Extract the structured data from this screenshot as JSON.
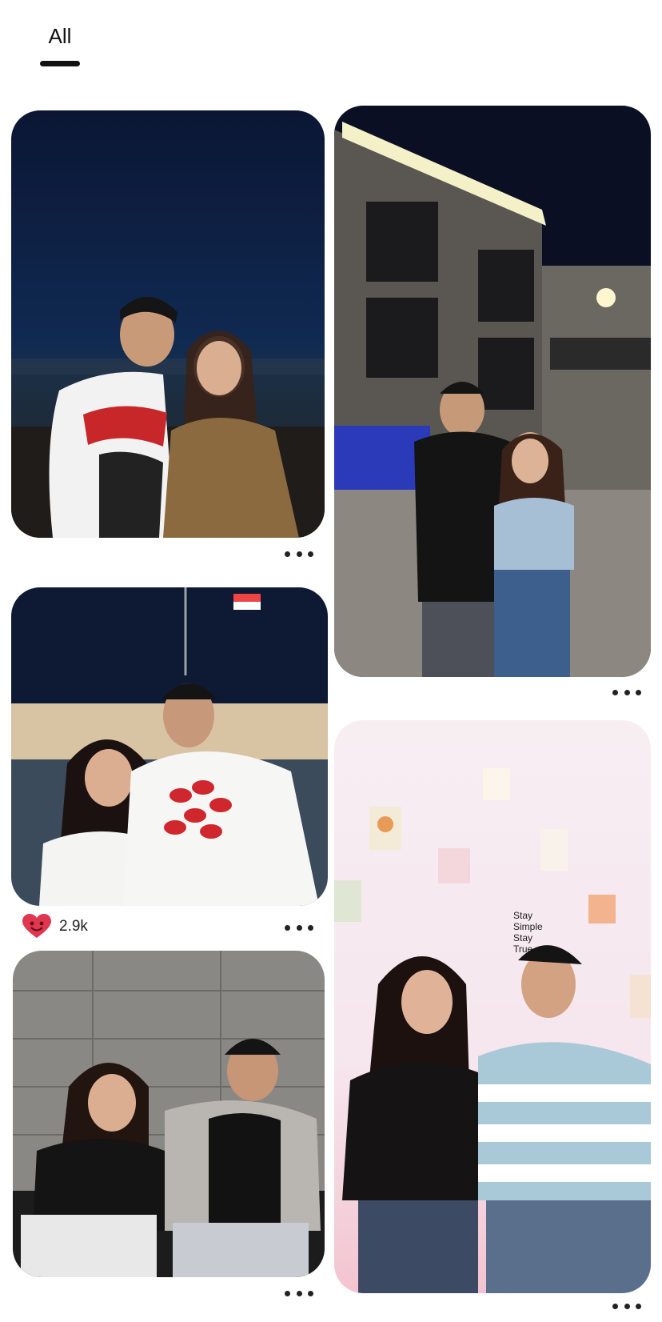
{
  "tabs": [
    {
      "label": "All",
      "active": true
    }
  ],
  "pins": [
    {
      "id": "pin-1",
      "reactions": null
    },
    {
      "id": "pin-2",
      "reactions": null
    },
    {
      "id": "pin-3",
      "reactions": {
        "icon": "heart-icon",
        "count": "2.9k",
        "color": "#e0364f"
      }
    },
    {
      "id": "pin-4",
      "reactions": null
    },
    {
      "id": "pin-5",
      "reactions": null
    }
  ],
  "colors": {
    "accent": "#111111",
    "heart": "#e0364f",
    "background": "#ffffff"
  }
}
